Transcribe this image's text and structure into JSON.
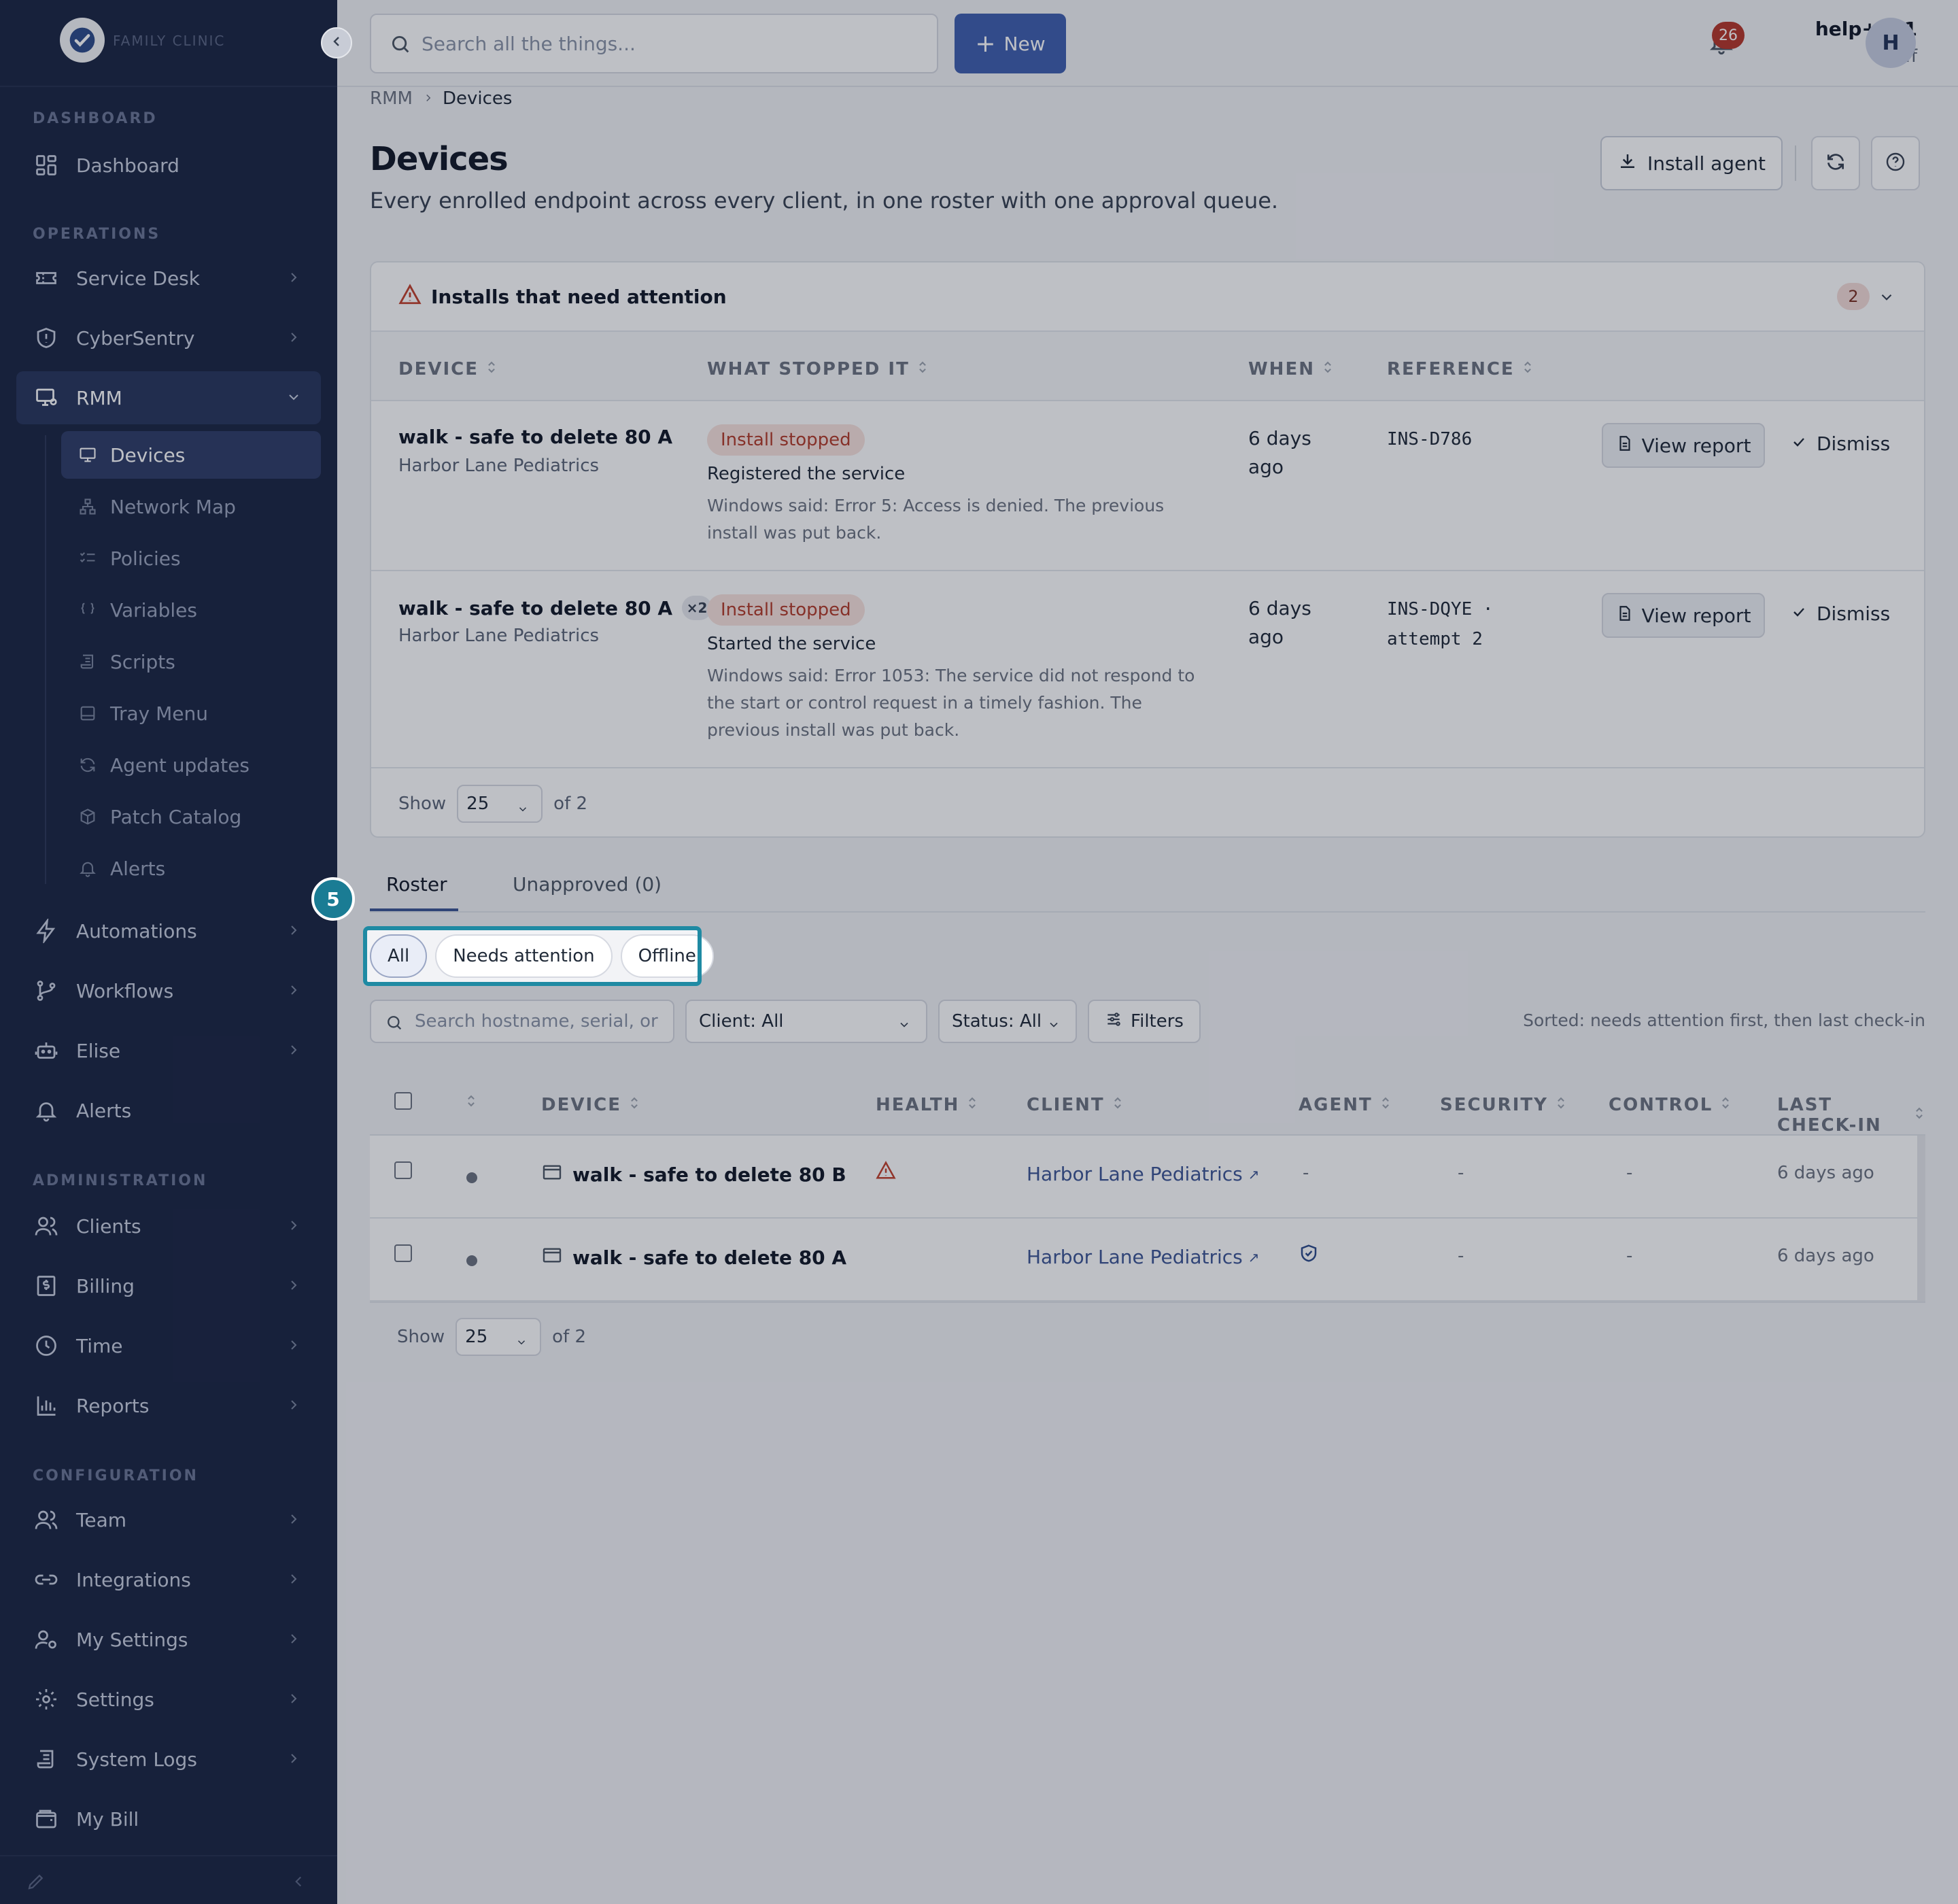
{
  "sidebar": {
    "logo_text": "FAMILY CLINIC",
    "sections": [
      {
        "heading": "DASHBOARD"
      },
      {
        "heading": "OPERATIONS"
      },
      {
        "heading": "ADMINISTRATION"
      },
      {
        "heading": "CONFIGURATION"
      }
    ],
    "items": {
      "dashboard": "Dashboard",
      "service_desk": "Service Desk",
      "cybersentry": "CyberSentry",
      "rmm": "RMM",
      "automations": "Automations",
      "workflows": "Workflows",
      "elise": "Elise",
      "alerts": "Alerts",
      "clients": "Clients",
      "billing": "Billing",
      "time": "Time",
      "reports": "Reports",
      "team": "Team",
      "integrations": "Integrations",
      "my_settings": "My Settings",
      "settings": "Settings",
      "system_logs": "System Logs",
      "my_bill": "My Bill"
    },
    "rmm_sub": {
      "devices": "Devices",
      "network_map": "Network Map",
      "policies": "Policies",
      "variables": "Variables",
      "scripts": "Scripts",
      "tray_menu": "Tray Menu",
      "agent_updates": "Agent updates",
      "patch_catalog": "Patch Catalog",
      "alerts": "Alerts"
    }
  },
  "topbar": {
    "search_placeholder": "Search all the things...",
    "new_label": "New",
    "notifications": "26",
    "user_name": "help+kb1",
    "user_role": "Staff",
    "avatar_initial": "H"
  },
  "breadcrumb": {
    "parent": "RMM",
    "current": "Devices"
  },
  "page": {
    "title": "Devices",
    "subtitle": "Every enrolled endpoint across every client, in one roster with one approval queue.",
    "install_agent": "Install agent"
  },
  "attention": {
    "title": "Installs that need attention",
    "count": "2",
    "columns": {
      "device": "DEVICE",
      "what": "WHAT STOPPED IT",
      "when": "WHEN",
      "reference": "REFERENCE"
    },
    "rows": [
      {
        "device": "walk - safe to delete 80 A",
        "client": "Harbor Lane Pediatrics",
        "status": "Install stopped",
        "step": "Registered the service",
        "detail": "Windows said: Error 5: Access is denied. The previous install was put back.",
        "when": "6 days ago",
        "reference": "INS-D786",
        "view": "View report",
        "dismiss": "Dismiss"
      },
      {
        "device": "walk - safe to delete 80 A",
        "multiplier": "×2",
        "client": "Harbor Lane Pediatrics",
        "status": "Install stopped",
        "step": "Started the service",
        "detail": "Windows said: Error 1053: The service did not respond to the start or control request in a timely fashion. The previous install was put back.",
        "when": "6 days ago",
        "reference": "INS-DQYE · attempt 2",
        "view": "View report",
        "dismiss": "Dismiss"
      }
    ],
    "pager": {
      "show": "Show",
      "size": "25",
      "of": "of 2"
    }
  },
  "tabs": {
    "roster": "Roster",
    "unapproved": "Unapproved (0)"
  },
  "chips": {
    "all": "All",
    "needs_attention": "Needs attention",
    "offline": "Offline"
  },
  "filters": {
    "search_placeholder": "Search hostname, serial, or",
    "client": "Client: All",
    "status": "Status: All",
    "filters": "Filters",
    "sorted_note": "Sorted: needs attention first, then last check-in"
  },
  "roster": {
    "columns": {
      "device": "DEVICE",
      "health": "HEALTH",
      "client": "CLIENT",
      "agent": "AGENT",
      "security": "SECURITY",
      "control": "CONTROL",
      "last": "LAST CHECK-IN"
    },
    "rows": [
      {
        "device": "walk - safe to delete 80 B",
        "client": "Harbor Lane Pediatrics",
        "agent": "-",
        "security": "-",
        "control": "-",
        "last": "6 days ago"
      },
      {
        "device": "walk - safe to delete 80 A",
        "client": "Harbor Lane Pediatrics",
        "security": "-",
        "control": "-",
        "last": "6 days ago"
      }
    ],
    "pager": {
      "show": "Show",
      "size": "25",
      "of": "of 2"
    }
  },
  "tour": {
    "step": "5",
    "accent": "#1f8aa3"
  }
}
